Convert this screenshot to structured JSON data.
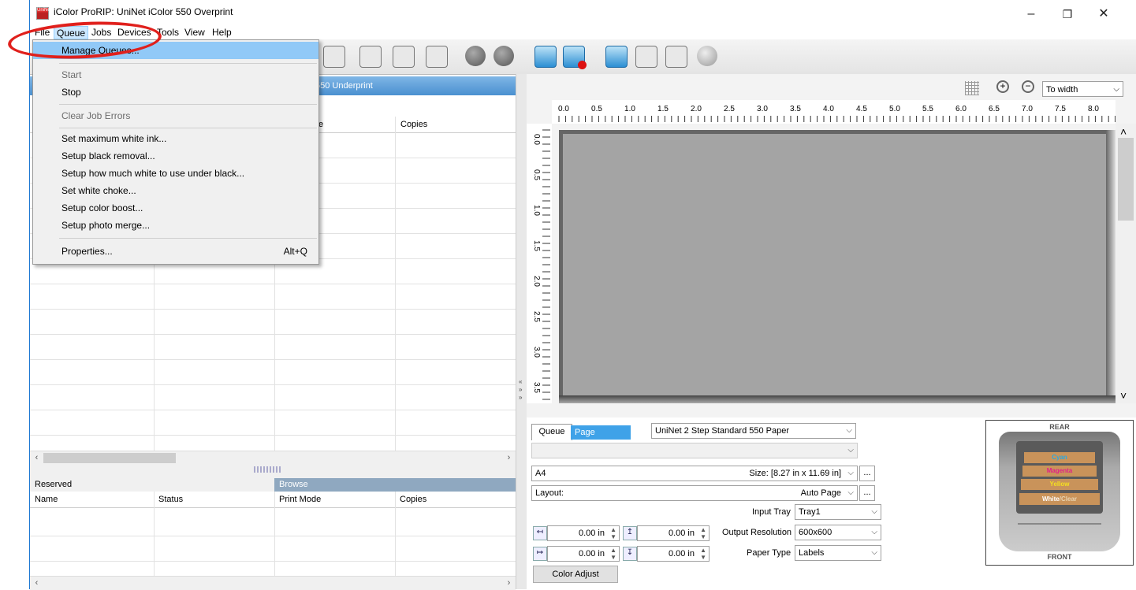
{
  "window": {
    "title": "iColor ProRIP: UniNet iColor 550 Overprint",
    "app_icon_text": "UniNet",
    "minimize": "–",
    "restore": "❐",
    "close": "✕"
  },
  "menubar": [
    "File",
    "Queue",
    "Jobs",
    "Devices",
    "Tools",
    "View",
    "Help"
  ],
  "queue_menu": {
    "items": [
      {
        "label": "Manage Queues...",
        "shortcut": "",
        "disabled": false,
        "highlighted": true
      },
      {
        "label": "Start",
        "shortcut": "",
        "disabled": true
      },
      {
        "label": "Stop",
        "shortcut": "",
        "disabled": false
      },
      {
        "label": "Clear Job Errors",
        "shortcut": "",
        "disabled": true
      },
      {
        "label": "Set maximum white ink...",
        "shortcut": "",
        "disabled": false
      },
      {
        "label": "Setup black removal...",
        "shortcut": "",
        "disabled": false
      },
      {
        "label": "Setup how much white to use under black...",
        "shortcut": "",
        "disabled": false
      },
      {
        "label": "Set white choke...",
        "shortcut": "",
        "disabled": false
      },
      {
        "label": "Setup color boost...",
        "shortcut": "",
        "disabled": false
      },
      {
        "label": "Setup photo merge...",
        "shortcut": "",
        "disabled": false
      },
      {
        "label": "Properties...",
        "shortcut": "Alt+Q",
        "disabled": false
      }
    ]
  },
  "left_panel": {
    "header_tab": "550 Underprint",
    "columns_top": [
      "",
      "",
      "e",
      "Copies"
    ],
    "bottom_tabs": {
      "reserved": "Reserved",
      "browse": "Browse"
    },
    "columns_bottom": [
      "Name",
      "Status",
      "Print Mode",
      "Copies"
    ]
  },
  "ruler": {
    "h_labels": [
      "0.0",
      "0.5",
      "1.0",
      "1.5",
      "2.0",
      "2.5",
      "3.0",
      "3.5",
      "4.0",
      "4.5",
      "5.0",
      "5.5",
      "6.0",
      "6.5",
      "7.0",
      "7.5",
      "8.0"
    ],
    "v_labels": [
      "0.0",
      "0.5",
      "1.0",
      "1.5",
      "2.0",
      "2.5",
      "3.0",
      "3.5"
    ]
  },
  "zoom": {
    "value": "To width"
  },
  "settings": {
    "tab_queue": "Queue",
    "tab_page": "Page",
    "media": "UniNet 2 Step Standard 550 Paper",
    "paper_name": "A4",
    "size_text": "Size: [8.27 in x 11.69 in]",
    "layout_label": "Layout:",
    "layout_value": "Auto Page",
    "ellipsis": "...",
    "input_tray_label": "Input Tray",
    "input_tray_value": "Tray1",
    "output_res_label": "Output Resolution",
    "output_res_value": "600x600",
    "paper_type_label": "Paper Type",
    "paper_type_value": "Labels",
    "margin_values": [
      "0.00 in",
      "0.00 in",
      "0.00 in",
      "0.00 in"
    ],
    "color_adjust": "Color Adjust"
  },
  "printer_diagram": {
    "rear": "REAR",
    "front": "FRONT",
    "cartridges": [
      {
        "label": "Cyan",
        "color": "#2aa8e0"
      },
      {
        "label": "Magenta",
        "color": "#e0208a"
      },
      {
        "label": "Yellow",
        "color": "#f5e020"
      }
    ],
    "white_label": "White",
    "clear_label": "/Clear"
  }
}
